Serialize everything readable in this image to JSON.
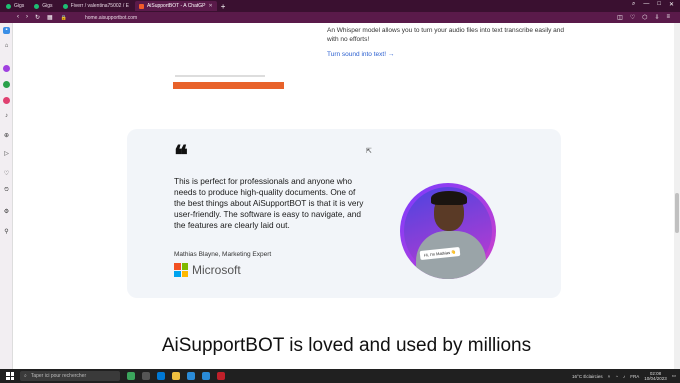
{
  "browser": {
    "tabs": [
      {
        "label": "Gigs",
        "active": false
      },
      {
        "label": "Gigs",
        "active": false
      },
      {
        "label": "Fiverr / valentina75002 / E",
        "active": false
      },
      {
        "label": "AiSupportBOT - A ChatGP",
        "active": true
      }
    ],
    "new_tab": "+",
    "url": "home.aisupportbot.com"
  },
  "page": {
    "whisper_text": "An Whisper model allows you to turn your audio files into text transcribe easily and with no efforts!",
    "whisper_link": "Turn sound into text! →",
    "testimonial": {
      "quote_mark": "❝",
      "quote": "This is perfect for professionals and anyone who needs to produce high-quality documents. One of the best things about AiSupportBOT is that it is very user-friendly. The software is easy to navigate, and the features are clearly laid out.",
      "author": "Mathias Blayne, Marketing Expert",
      "company": "Microsoft",
      "avatar_tag": "Hi, I'm Mathias 👋"
    },
    "headline": "AiSupportBOT is loved and used by millions"
  },
  "taskbar": {
    "search_placeholder": "Taper ici pour rechercher",
    "weather": "16°C  Éclaircies",
    "lang": "FRA",
    "time": "02:08",
    "date": "10/04/2023"
  },
  "colors": {
    "tab_bar": "#3a1030",
    "address_bar": "#5a1a4a",
    "card_bg": "#f2f5f9",
    "link": "#2a5fd0",
    "accent_orange": "#e8622a"
  }
}
